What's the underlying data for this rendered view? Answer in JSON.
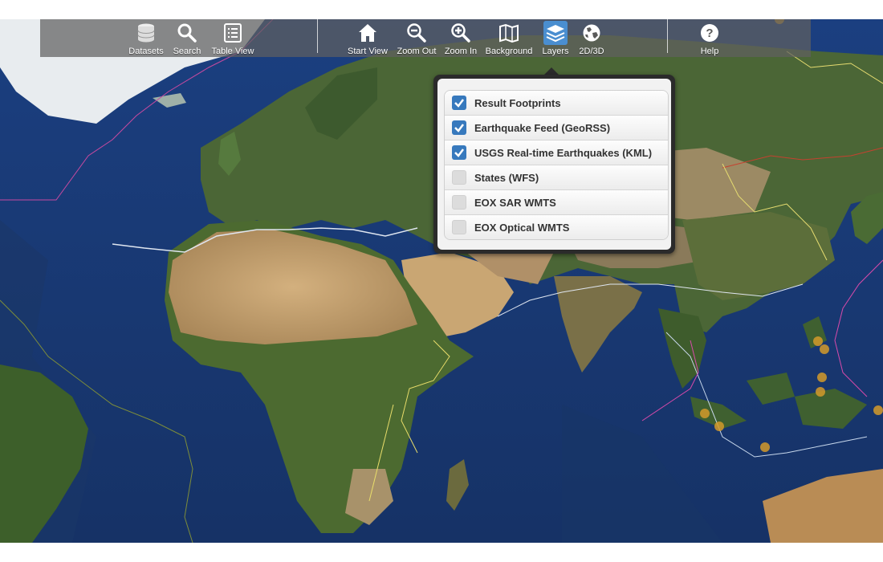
{
  "toolbar": {
    "datasets": {
      "label": "Datasets",
      "icon": "database-icon"
    },
    "search": {
      "label": "Search",
      "icon": "search-icon"
    },
    "table_view": {
      "label": "Table View",
      "icon": "list-icon"
    },
    "start_view": {
      "label": "Start View",
      "icon": "home-icon"
    },
    "zoom_out": {
      "label": "Zoom Out",
      "icon": "zoom-out-icon"
    },
    "zoom_in": {
      "label": "Zoom In",
      "icon": "zoom-in-icon"
    },
    "background": {
      "label": "Background",
      "icon": "map-icon"
    },
    "layers": {
      "label": "Layers",
      "icon": "layers-icon",
      "active": true
    },
    "mode_2d3d": {
      "label": "2D/3D",
      "icon": "globe-icon"
    },
    "help": {
      "label": "Help",
      "icon": "help-icon"
    }
  },
  "layers_panel": {
    "items": [
      {
        "label": "Result Footprints",
        "checked": true
      },
      {
        "label": "Earthquake Feed (GeoRSS)",
        "checked": true
      },
      {
        "label": "USGS Real-time Earthquakes (KML)",
        "checked": true
      },
      {
        "label": "States (WFS)",
        "checked": false
      },
      {
        "label": "EOX SAR WMTS",
        "checked": false
      },
      {
        "label": "EOX Optical WMTS",
        "checked": false
      }
    ]
  },
  "colors": {
    "ocean": "#1e3d7a",
    "land_green": "#3b5a2a",
    "desert": "#c2a070",
    "accent": "#3779bd",
    "earthquake": "#d39a2a"
  }
}
